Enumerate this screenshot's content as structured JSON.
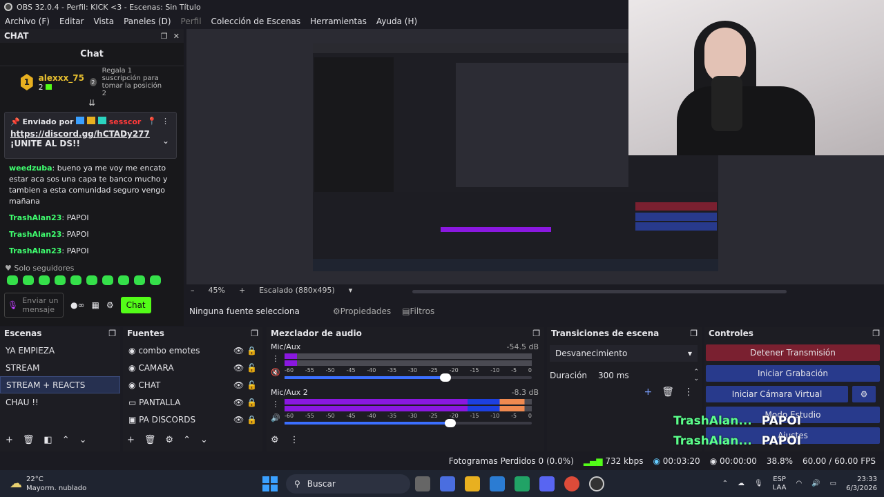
{
  "titlebar": {
    "title": "OBS 32.0.4 - Perfil: KICK <3 - Escenas: Sin Título"
  },
  "menu": [
    "Archivo (F)",
    "Editar",
    "Vista",
    "Paneles (D)",
    "Perfil",
    "Colección de Escenas",
    "Herramientas",
    "Ayuda (H)"
  ],
  "chat": {
    "dock_title": "CHAT",
    "title": "Chat",
    "leader": {
      "rank": "1",
      "name": "alexxx_75",
      "count": "2",
      "rank2": "2",
      "cta": "Regala 1 suscripción para tomar la posición 2"
    },
    "pinned": {
      "by": "Enviado por",
      "user": "sesscor",
      "link": "https://discord.gg/hCTADy277",
      "text": "¡UNITE AL DS!!"
    },
    "messages": [
      {
        "user": "weedzuba",
        "text": "bueno ya me voy me encato estar aca sos una capa te banco mucho y tambien a esta comunidad seguro vengo mañana"
      },
      {
        "user": "TrashAlan23",
        "text": "PAPOI"
      },
      {
        "user": "TrashAlan23",
        "text": "PAPOI"
      },
      {
        "user": "TrashAlan23",
        "text": "PAPOI"
      }
    ],
    "followers_only": "Solo seguidores",
    "input_placeholder": "Enviar un mensaje",
    "send_label": "Chat"
  },
  "preview": {
    "zoom": "45%",
    "scaling": "Escalado (880x495)",
    "no_source": "Ninguna fuente selecciona",
    "props": "Propiedades",
    "filters": "Filtros"
  },
  "scenes": {
    "title": "Escenas",
    "items": [
      "YA EMPIEZA",
      "STREAM",
      "STREAM + REACTS",
      "CHAU !!"
    ],
    "selected": "STREAM + REACTS"
  },
  "sources": {
    "title": "Fuentes",
    "items": [
      "combo emotes",
      "CAMARA",
      "CHAT",
      "PANTALLA",
      "PA DISCORDS"
    ]
  },
  "mixer": {
    "title": "Mezclador de audio",
    "channels": [
      {
        "name": "Mic/Aux",
        "db": "-54.5 dB",
        "level": 0.05,
        "volume": 0.65
      },
      {
        "name": "Mic/Aux 2",
        "db": "-8.3 dB",
        "level": 0.97,
        "volume": 0.67
      }
    ],
    "ticks": [
      "-60",
      "-55",
      "-50",
      "-45",
      "-40",
      "-35",
      "-30",
      "-25",
      "-20",
      "-15",
      "-10",
      "-5",
      "0"
    ]
  },
  "transitions": {
    "title": "Transiciones de escena",
    "type": "Desvanecimiento",
    "duration_label": "Duración",
    "duration": "300 ms"
  },
  "controls": {
    "title": "Controles",
    "stop": "Detener Transmisión",
    "record": "Iniciar Grabación",
    "vcam": "Iniciar Cámara Virtual",
    "studio": "Modo Estudio",
    "settings": "Ajustes"
  },
  "overlay": {
    "user": "TrashAlan...",
    "msg": "PAPOI"
  },
  "status": {
    "frames": "Fotogramas Perdidos 0 (0.0%)",
    "kbps": "732 kbps",
    "time1": "00:03:20",
    "time2": "00:00:00",
    "cpu": "38.8%",
    "fps": "60.00 / 60.00 FPS"
  },
  "taskbar": {
    "temp": "22°C",
    "weather": "Mayorm. nublado",
    "search": "Buscar",
    "lang1": "ESP",
    "lang2": "LAA",
    "time": "23:33",
    "date": "6/3/2026"
  },
  "colors": {
    "stop": "#7a2030",
    "blue": "#283a8c",
    "green": "#53fc18"
  }
}
